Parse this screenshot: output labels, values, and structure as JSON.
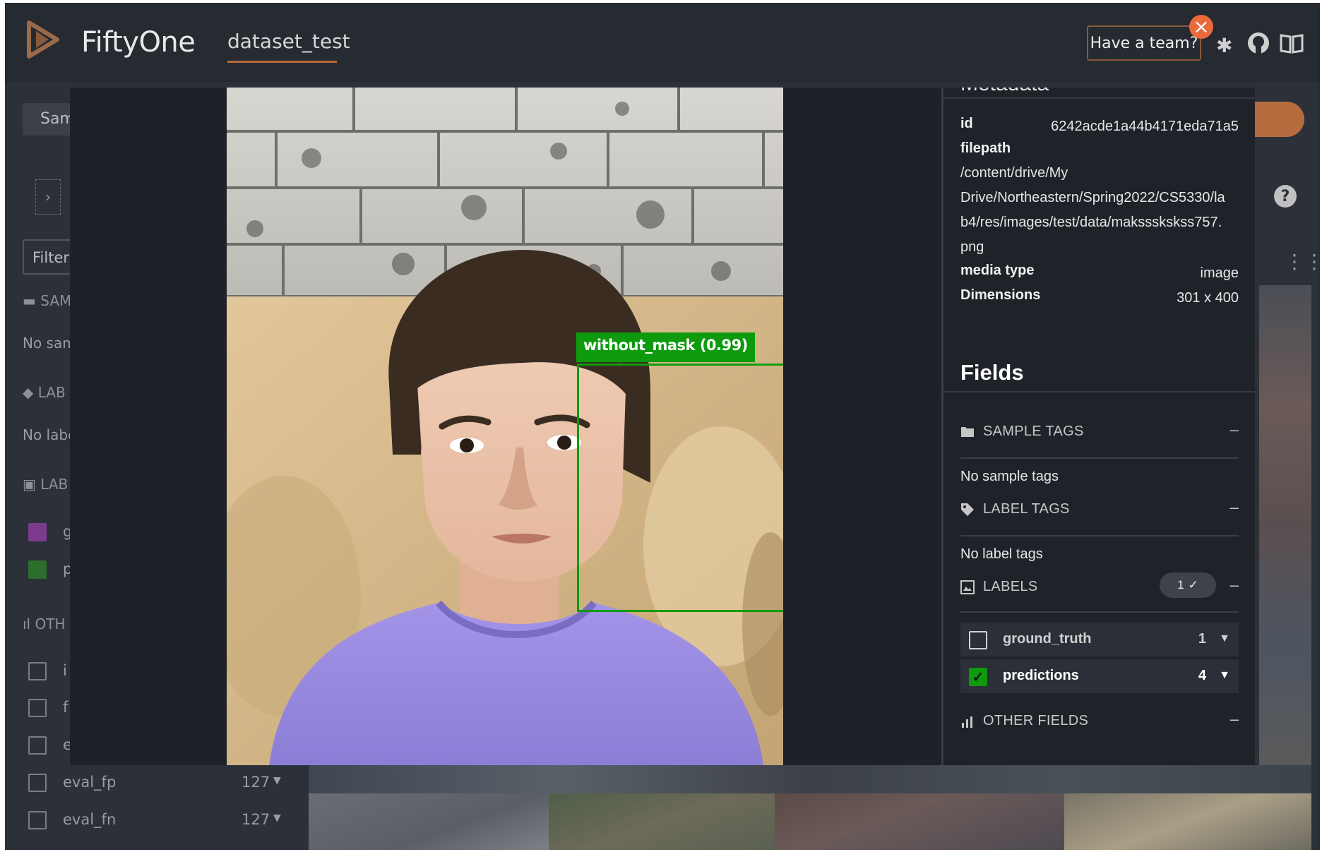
{
  "header": {
    "brand": "FiftyOne",
    "dataset_name": "dataset_test",
    "team_button": "Have a team?"
  },
  "sidebar": {
    "sample_button": "Samp",
    "filters_button": "Filters",
    "sample_tags_head": "SAM",
    "no_sample_text": "No sam",
    "label_tags_head": "LAB",
    "no_label_text": "No labe",
    "labels_head": "LAB",
    "label_rows": [
      {
        "label": "g",
        "color": "#7c3b8f"
      },
      {
        "label": "p",
        "color": "#2c6e2c"
      }
    ],
    "other_head": "OTH",
    "other_rows": [
      {
        "label": "i",
        "count": ""
      },
      {
        "label": "f",
        "count": ""
      },
      {
        "label": "e",
        "count": ""
      },
      {
        "label": "eval_fp",
        "count": "127"
      },
      {
        "label": "eval_fn",
        "count": "127"
      }
    ]
  },
  "viewer": {
    "detection_label": "without_mask (0.99)",
    "detection_color": "#0d9b0d"
  },
  "panel": {
    "metadata_title": "Metadata",
    "metadata": {
      "id_key": "id",
      "id_value": "6242acde1a44b4171eda71a5",
      "filepath_key": "filepath",
      "filepath_lines": [
        "/content/drive/My",
        "Drive/Northeastern/Spring2022/CS5330/la",
        "b4/res/images/test/data/makssskskss757.",
        "png"
      ],
      "media_type_key": "media type",
      "media_type_value": "image",
      "dimensions_key": "Dimensions",
      "dimensions_value": "301 x 400"
    },
    "fields_title": "Fields",
    "sample_tags": {
      "title": "SAMPLE TAGS",
      "empty": "No sample tags"
    },
    "label_tags": {
      "title": "LABEL TAGS",
      "empty": "No label tags"
    },
    "labels": {
      "title": "LABELS",
      "pill_count": "1",
      "rows": [
        {
          "name": "ground_truth",
          "count": "1",
          "checked": false
        },
        {
          "name": "predictions",
          "count": "4",
          "checked": true
        }
      ]
    },
    "other_fields": {
      "title": "OTHER FIELDS"
    },
    "collapse_symbol": "–"
  }
}
